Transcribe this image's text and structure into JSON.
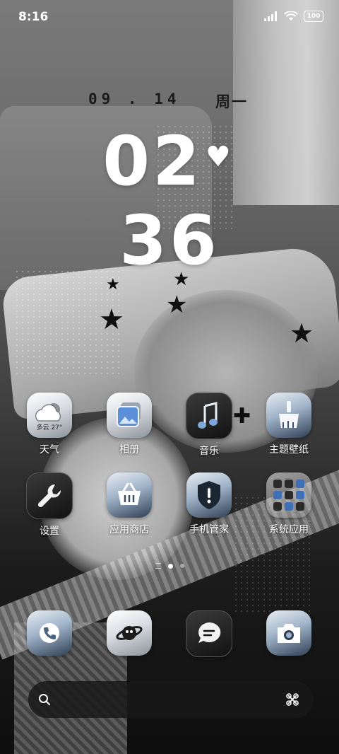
{
  "status_bar": {
    "time": "8:16",
    "battery": "100"
  },
  "clock": {
    "date": "09 . 14",
    "weekday": "周一",
    "hours": "02",
    "minutes": "36"
  },
  "apps": [
    {
      "label": "天气",
      "icon": "weather-icon",
      "extra_text": "多云 27°"
    },
    {
      "label": "相册",
      "icon": "gallery-icon"
    },
    {
      "label": "音乐",
      "icon": "music-note-icon"
    },
    {
      "label": "主题壁纸",
      "icon": "paintbrush-icon"
    },
    {
      "label": "设置",
      "icon": "wrench-icon"
    },
    {
      "label": "应用商店",
      "icon": "shopping-basket-icon"
    },
    {
      "label": "手机管家",
      "icon": "shield-icon"
    },
    {
      "label": "系统应用",
      "icon": "folder-icon"
    }
  ],
  "dock": [
    {
      "icon": "phone-icon"
    },
    {
      "icon": "planet-browser-icon"
    },
    {
      "icon": "message-bubble-icon"
    },
    {
      "icon": "camera-icon"
    }
  ],
  "pager": {
    "pages": 3,
    "current": 2
  },
  "search": {
    "left_icon": "search-icon",
    "right_icon": "scan-icon"
  },
  "colors": {
    "accent_blue": "#3f6fb5",
    "dark_icon_bg": "#121212",
    "text": "#ffffff"
  }
}
